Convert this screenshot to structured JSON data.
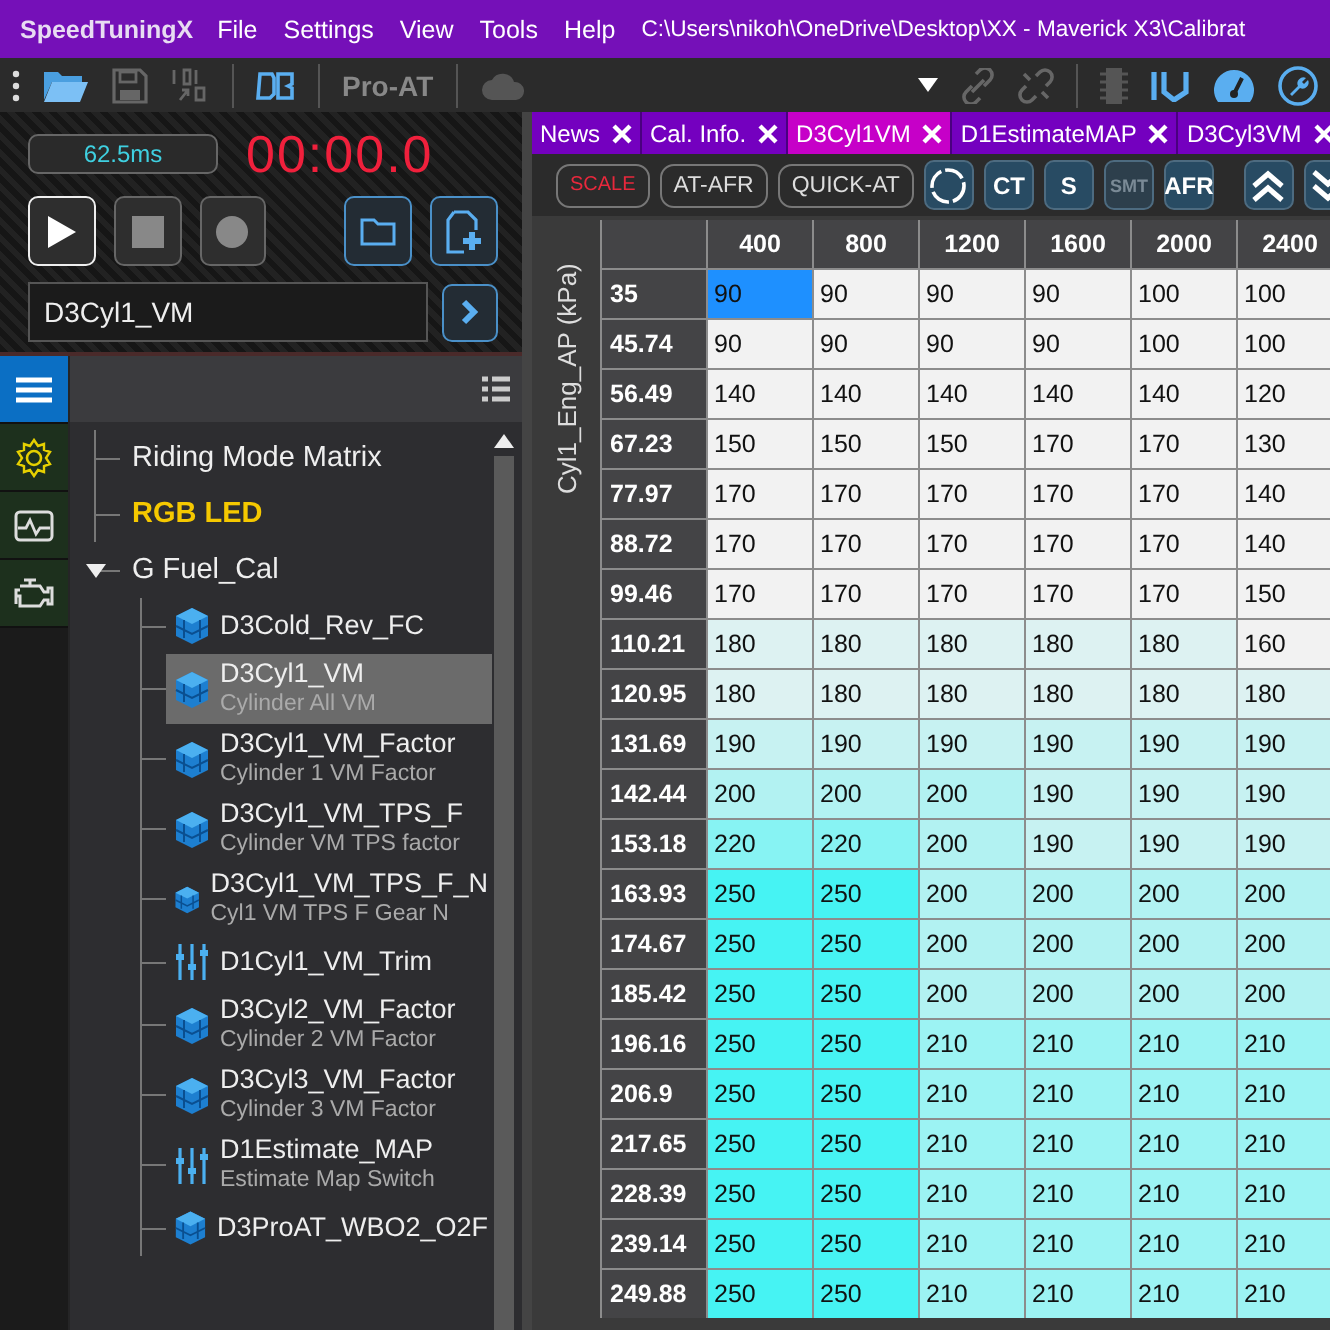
{
  "app_name": "SpeedTuningX",
  "menu": [
    "File",
    "Settings",
    "View",
    "Tools",
    "Help"
  ],
  "window": {
    "title": "C:\\Users\\nikoh\\OneDrive\\Desktop\\XX - Maverick X3\\Calibrat"
  },
  "toolbar": {
    "pro_at": {
      "label": "Pro-AT",
      "disabled": true
    }
  },
  "logger": {
    "interval": "62.5ms",
    "timer": "00:00.0"
  },
  "search": {
    "value": "D3Cyl1_VM"
  },
  "side_nav": [
    {
      "kind": "menu",
      "selected": true
    },
    {
      "kind": "settings",
      "selected": false
    },
    {
      "kind": "monitor",
      "selected": false
    },
    {
      "kind": "engine",
      "selected": false
    }
  ],
  "tree": [
    {
      "label": "Riding Mode Matrix",
      "highlighted": false
    },
    {
      "label": "RGB LED",
      "highlighted": true
    },
    {
      "label": "G Fuel_Cal",
      "highlighted": false,
      "expanded": true,
      "children": [
        {
          "kind": "table",
          "label": "D3Cold_Rev_FC",
          "selected": false
        },
        {
          "kind": "table",
          "label": "D3Cyl1_VM",
          "description": "Cylinder All VM",
          "selected": true
        },
        {
          "kind": "table",
          "label": "D3Cyl1_VM_Factor",
          "description": "Cylinder 1 VM Factor",
          "selected": false
        },
        {
          "kind": "table",
          "label": "D3Cyl1_VM_TPS_F",
          "description": "Cylinder VM TPS factor",
          "selected": false
        },
        {
          "kind": "table",
          "label": "D3Cyl1_VM_TPS_F_N",
          "description": "Cyl1 VM TPS F Gear N",
          "selected": false
        },
        {
          "kind": "switch",
          "label": "D1Cyl1_VM_Trim",
          "selected": false
        },
        {
          "kind": "table",
          "label": "D3Cyl2_VM_Factor",
          "description": "Cylinder 2 VM Factor",
          "selected": false
        },
        {
          "kind": "table",
          "label": "D3Cyl3_VM_Factor",
          "description": "Cylinder 3 VM Factor",
          "selected": false
        },
        {
          "kind": "switch",
          "label": "D1Estimate_MAP",
          "description": "Estimate Map Switch",
          "selected": false
        },
        {
          "kind": "table",
          "label": "D3ProAT_WBO2_O2F",
          "selected": false
        }
      ]
    }
  ],
  "tabs": [
    {
      "label": "News",
      "selected": false
    },
    {
      "label": "Cal. Info.",
      "selected": false
    },
    {
      "label": "D3Cyl1VM",
      "selected": true
    },
    {
      "label": "D1EstimateMAP",
      "selected": false
    },
    {
      "label": "D3Cyl3VM",
      "selected": false
    }
  ],
  "map_toolbar": [
    {
      "kind": "alert",
      "label": "SCALE"
    },
    {
      "kind": "outline",
      "label": "AT-AFR"
    },
    {
      "kind": "outline",
      "label": "QUICK-AT"
    },
    {
      "kind": "ring"
    },
    {
      "kind": "tile",
      "label": "CT",
      "disabled": false
    },
    {
      "kind": "tile",
      "label": "S",
      "disabled": false
    },
    {
      "kind": "tile",
      "label": "SMT",
      "disabled": true
    },
    {
      "kind": "tile",
      "label": "AFR",
      "disabled": false
    },
    {
      "kind": "up"
    },
    {
      "kind": "down"
    }
  ],
  "table": {
    "y_axis_label": "Cyl1_Eng_AP (kPa)",
    "columns": [
      "400",
      "800",
      "1200",
      "1600",
      "2000",
      "2400"
    ],
    "rows": [
      {
        "label": "35",
        "cells": [
          {
            "value": "90",
            "selected": true
          },
          {
            "value": "90",
            "selected": false
          },
          {
            "value": "90",
            "selected": false
          },
          {
            "value": "90",
            "selected": false
          },
          {
            "value": "100",
            "selected": false
          },
          {
            "value": "100",
            "selected": false
          }
        ]
      },
      {
        "label": "45.74",
        "cells": [
          {
            "value": "90",
            "selected": false
          },
          {
            "value": "90",
            "selected": false
          },
          {
            "value": "90",
            "selected": false
          },
          {
            "value": "90",
            "selected": false
          },
          {
            "value": "100",
            "selected": false
          },
          {
            "value": "100",
            "selected": false
          }
        ]
      },
      {
        "label": "56.49",
        "cells": [
          {
            "value": "140",
            "selected": false
          },
          {
            "value": "140",
            "selected": false
          },
          {
            "value": "140",
            "selected": false
          },
          {
            "value": "140",
            "selected": false
          },
          {
            "value": "140",
            "selected": false
          },
          {
            "value": "120",
            "selected": false
          }
        ]
      },
      {
        "label": "67.23",
        "cells": [
          {
            "value": "150",
            "selected": false
          },
          {
            "value": "150",
            "selected": false
          },
          {
            "value": "150",
            "selected": false
          },
          {
            "value": "170",
            "selected": false
          },
          {
            "value": "170",
            "selected": false
          },
          {
            "value": "130",
            "selected": false
          }
        ]
      },
      {
        "label": "77.97",
        "cells": [
          {
            "value": "170",
            "selected": false
          },
          {
            "value": "170",
            "selected": false
          },
          {
            "value": "170",
            "selected": false
          },
          {
            "value": "170",
            "selected": false
          },
          {
            "value": "170",
            "selected": false
          },
          {
            "value": "140",
            "selected": false
          }
        ]
      },
      {
        "label": "88.72",
        "cells": [
          {
            "value": "170",
            "selected": false
          },
          {
            "value": "170",
            "selected": false
          },
          {
            "value": "170",
            "selected": false
          },
          {
            "value": "170",
            "selected": false
          },
          {
            "value": "170",
            "selected": false
          },
          {
            "value": "140",
            "selected": false
          }
        ]
      },
      {
        "label": "99.46",
        "cells": [
          {
            "value": "170",
            "selected": false
          },
          {
            "value": "170",
            "selected": false
          },
          {
            "value": "170",
            "selected": false
          },
          {
            "value": "170",
            "selected": false
          },
          {
            "value": "170",
            "selected": false
          },
          {
            "value": "150",
            "selected": false
          }
        ]
      },
      {
        "label": "110.21",
        "cells": [
          {
            "value": "180",
            "selected": false
          },
          {
            "value": "180",
            "selected": false
          },
          {
            "value": "180",
            "selected": false
          },
          {
            "value": "180",
            "selected": false
          },
          {
            "value": "180",
            "selected": false
          },
          {
            "value": "160",
            "selected": false
          }
        ]
      },
      {
        "label": "120.95",
        "cells": [
          {
            "value": "180",
            "selected": false
          },
          {
            "value": "180",
            "selected": false
          },
          {
            "value": "180",
            "selected": false
          },
          {
            "value": "180",
            "selected": false
          },
          {
            "value": "180",
            "selected": false
          },
          {
            "value": "180",
            "selected": false
          }
        ]
      },
      {
        "label": "131.69",
        "cells": [
          {
            "value": "190",
            "selected": false
          },
          {
            "value": "190",
            "selected": false
          },
          {
            "value": "190",
            "selected": false
          },
          {
            "value": "190",
            "selected": false
          },
          {
            "value": "190",
            "selected": false
          },
          {
            "value": "190",
            "selected": false
          }
        ]
      },
      {
        "label": "142.44",
        "cells": [
          {
            "value": "200",
            "selected": false
          },
          {
            "value": "200",
            "selected": false
          },
          {
            "value": "200",
            "selected": false
          },
          {
            "value": "190",
            "selected": false
          },
          {
            "value": "190",
            "selected": false
          },
          {
            "value": "190",
            "selected": false
          }
        ]
      },
      {
        "label": "153.18",
        "cells": [
          {
            "value": "220",
            "selected": false
          },
          {
            "value": "220",
            "selected": false
          },
          {
            "value": "200",
            "selected": false
          },
          {
            "value": "190",
            "selected": false
          },
          {
            "value": "190",
            "selected": false
          },
          {
            "value": "190",
            "selected": false
          }
        ]
      },
      {
        "label": "163.93",
        "cells": [
          {
            "value": "250",
            "selected": false
          },
          {
            "value": "250",
            "selected": false
          },
          {
            "value": "200",
            "selected": false
          },
          {
            "value": "200",
            "selected": false
          },
          {
            "value": "200",
            "selected": false
          },
          {
            "value": "200",
            "selected": false
          }
        ]
      },
      {
        "label": "174.67",
        "cells": [
          {
            "value": "250",
            "selected": false
          },
          {
            "value": "250",
            "selected": false
          },
          {
            "value": "200",
            "selected": false
          },
          {
            "value": "200",
            "selected": false
          },
          {
            "value": "200",
            "selected": false
          },
          {
            "value": "200",
            "selected": false
          }
        ]
      },
      {
        "label": "185.42",
        "cells": [
          {
            "value": "250",
            "selected": false
          },
          {
            "value": "250",
            "selected": false
          },
          {
            "value": "200",
            "selected": false
          },
          {
            "value": "200",
            "selected": false
          },
          {
            "value": "200",
            "selected": false
          },
          {
            "value": "200",
            "selected": false
          }
        ]
      },
      {
        "label": "196.16",
        "cells": [
          {
            "value": "250",
            "selected": false
          },
          {
            "value": "250",
            "selected": false
          },
          {
            "value": "210",
            "selected": false
          },
          {
            "value": "210",
            "selected": false
          },
          {
            "value": "210",
            "selected": false
          },
          {
            "value": "210",
            "selected": false
          }
        ]
      },
      {
        "label": "206.9",
        "cells": [
          {
            "value": "250",
            "selected": false
          },
          {
            "value": "250",
            "selected": false
          },
          {
            "value": "210",
            "selected": false
          },
          {
            "value": "210",
            "selected": false
          },
          {
            "value": "210",
            "selected": false
          },
          {
            "value": "210",
            "selected": false
          }
        ]
      },
      {
        "label": "217.65",
        "cells": [
          {
            "value": "250",
            "selected": false
          },
          {
            "value": "250",
            "selected": false
          },
          {
            "value": "210",
            "selected": false
          },
          {
            "value": "210",
            "selected": false
          },
          {
            "value": "210",
            "selected": false
          },
          {
            "value": "210",
            "selected": false
          }
        ]
      },
      {
        "label": "228.39",
        "cells": [
          {
            "value": "250",
            "selected": false
          },
          {
            "value": "250",
            "selected": false
          },
          {
            "value": "210",
            "selected": false
          },
          {
            "value": "210",
            "selected": false
          },
          {
            "value": "210",
            "selected": false
          },
          {
            "value": "210",
            "selected": false
          }
        ]
      },
      {
        "label": "239.14",
        "cells": [
          {
            "value": "250",
            "selected": false
          },
          {
            "value": "250",
            "selected": false
          },
          {
            "value": "210",
            "selected": false
          },
          {
            "value": "210",
            "selected": false
          },
          {
            "value": "210",
            "selected": false
          },
          {
            "value": "210",
            "selected": false
          }
        ]
      },
      {
        "label": "249.88",
        "cells": [
          {
            "value": "250",
            "selected": false
          },
          {
            "value": "250",
            "selected": false
          },
          {
            "value": "210",
            "selected": false
          },
          {
            "value": "210",
            "selected": false
          },
          {
            "value": "210",
            "selected": false
          },
          {
            "value": "210",
            "selected": false
          }
        ]
      }
    ]
  }
}
